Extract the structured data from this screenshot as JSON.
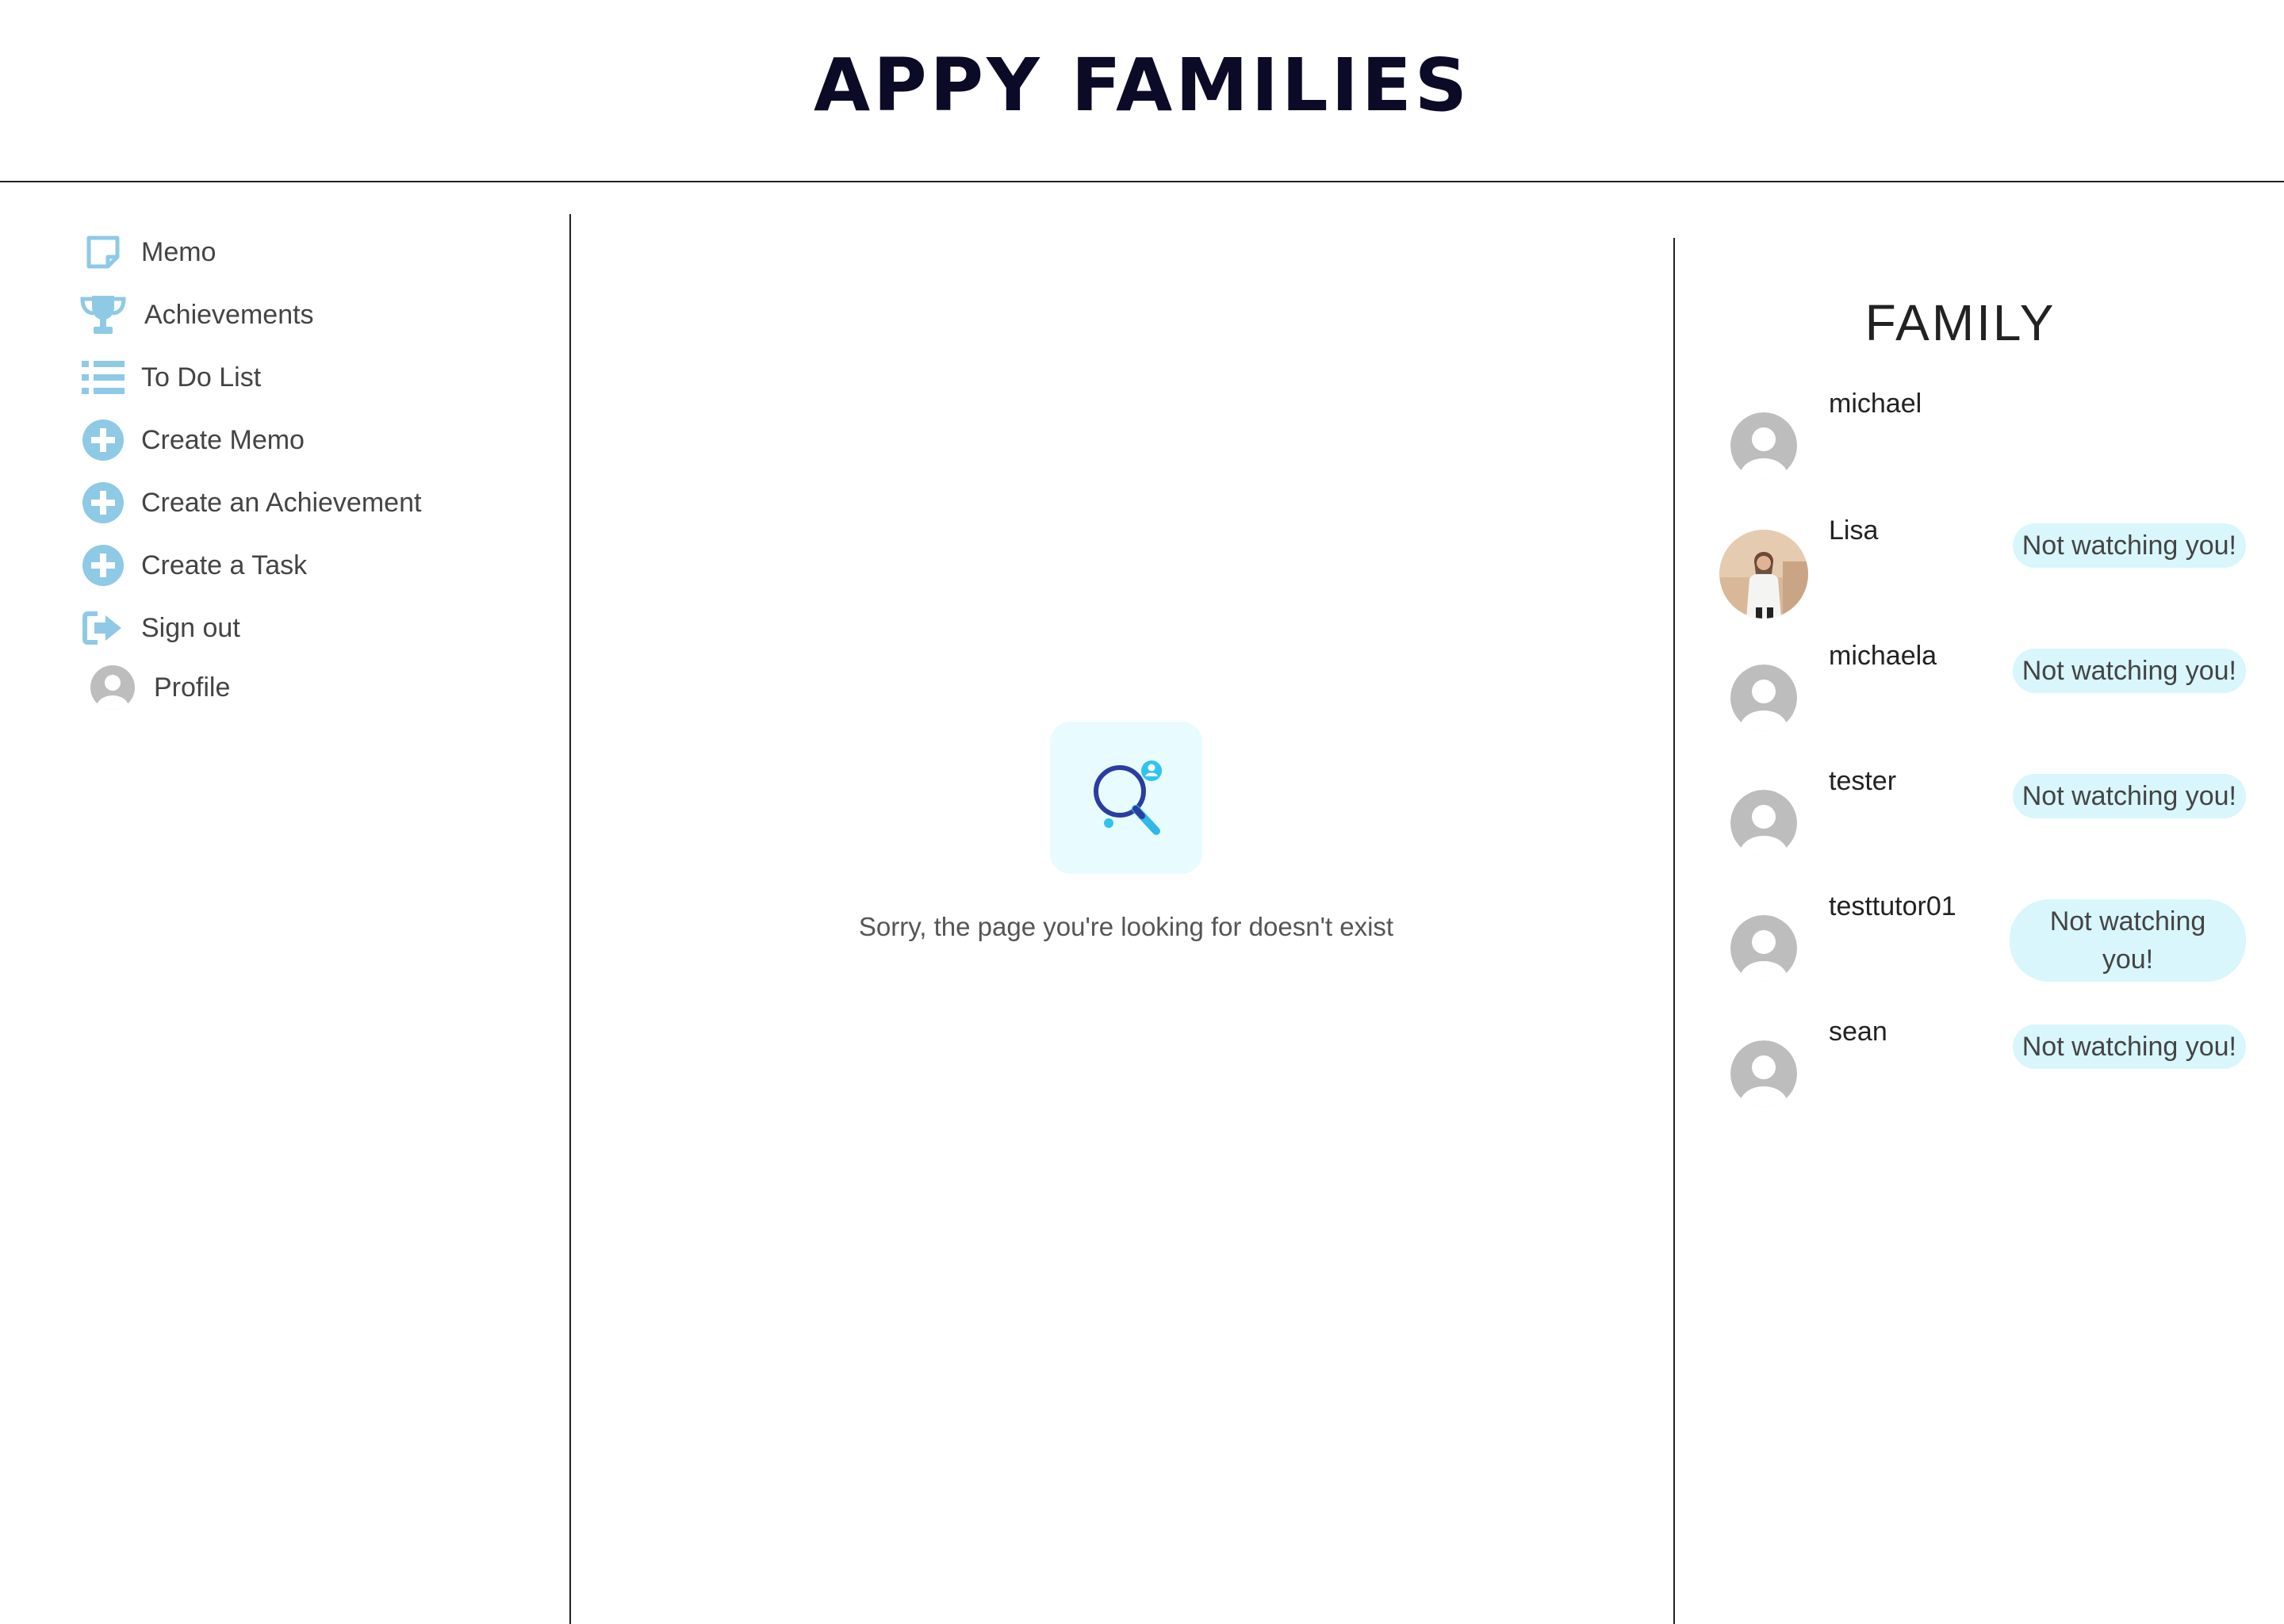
{
  "header": {
    "title": "APPY FAMILIES"
  },
  "nav": {
    "items": [
      {
        "label": "Memo",
        "icon": "memo-icon"
      },
      {
        "label": "Achievements",
        "icon": "trophy-icon"
      },
      {
        "label": "To Do List",
        "icon": "list-icon"
      },
      {
        "label": "Create Memo",
        "icon": "plus-circle-icon"
      },
      {
        "label": "Create an Achievement",
        "icon": "plus-circle-icon"
      },
      {
        "label": "Create a Task",
        "icon": "plus-circle-icon"
      },
      {
        "label": "Sign out",
        "icon": "sign-out-icon"
      },
      {
        "label": "Profile",
        "icon": "avatar-icon"
      }
    ]
  },
  "main": {
    "message": "Sorry, the page you're looking for doesn't exist",
    "icon": "search-user-icon"
  },
  "family": {
    "title": "FAMILY",
    "members": [
      {
        "name": "michael",
        "status": ""
      },
      {
        "name": "Lisa",
        "status": "Not watching you!"
      },
      {
        "name": "michaela",
        "status": "Not watching you!"
      },
      {
        "name": "tester",
        "status": "Not watching you!"
      },
      {
        "name": "testtutor01",
        "status": "Not watching you!"
      },
      {
        "name": "sean",
        "status": "Not watching you!"
      }
    ]
  },
  "colors": {
    "accent": "#8ecae6",
    "title": "#0b0b28",
    "badge_bg": "#d8f6fc",
    "avatar_gray": "#bdbdbd"
  }
}
